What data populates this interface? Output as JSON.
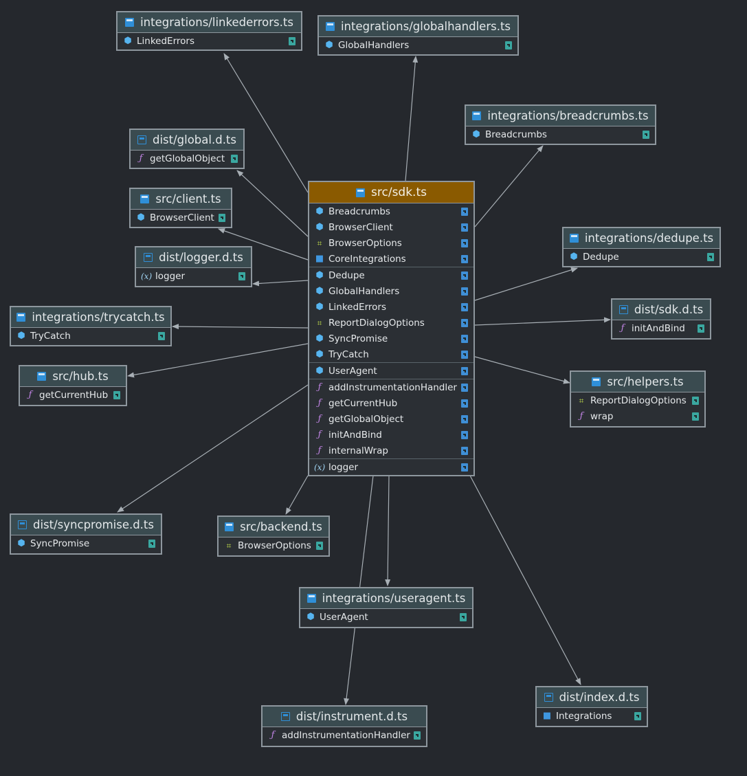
{
  "colors": {
    "background": "#25282d",
    "main_header": "#8a5a00",
    "node_header": "#3a4b50",
    "edge": "#a8afb5",
    "class_icon": "#56b4ef",
    "function_icon": "#c285e6",
    "interface_icon": "#b8d34a",
    "export_icon": "#3aa7a0"
  },
  "main": {
    "title": "src/sdk.ts",
    "items": [
      {
        "kind": "class",
        "icon": "class-icon",
        "label": "Breadcrumbs"
      },
      {
        "kind": "class",
        "icon": "class-icon",
        "label": "BrowserClient"
      },
      {
        "kind": "iface",
        "icon": "interface-icon",
        "label": "BrowserOptions"
      },
      {
        "kind": "mod",
        "icon": "module-file-icon",
        "label": "CoreIntegrations"
      },
      {
        "kind": "class",
        "icon": "class-icon",
        "label": "Dedupe"
      },
      {
        "kind": "class",
        "icon": "class-icon",
        "label": "GlobalHandlers"
      },
      {
        "kind": "class",
        "icon": "class-icon",
        "label": "LinkedErrors"
      },
      {
        "kind": "iface",
        "icon": "interface-icon",
        "label": "ReportDialogOptions"
      },
      {
        "kind": "class",
        "icon": "class-icon",
        "label": "SyncPromise"
      },
      {
        "kind": "class",
        "icon": "class-icon",
        "label": "TryCatch"
      },
      {
        "kind": "class",
        "icon": "class-icon",
        "label": "UserAgent"
      },
      {
        "kind": "fn",
        "icon": "function-icon",
        "label": "addInstrumentationHandler"
      },
      {
        "kind": "fn",
        "icon": "function-icon",
        "label": "getCurrentHub"
      },
      {
        "kind": "fn",
        "icon": "function-icon",
        "label": "getGlobalObject"
      },
      {
        "kind": "fn",
        "icon": "function-icon",
        "label": "initAndBind"
      },
      {
        "kind": "fn",
        "icon": "function-icon",
        "label": "internalWrap"
      },
      {
        "kind": "var",
        "icon": "variable-icon",
        "label": "logger"
      }
    ]
  },
  "nodes": [
    {
      "id": "linkederrors",
      "title": "integrations/linkederrors.ts",
      "dts": false,
      "items": [
        {
          "kind": "class",
          "label": "LinkedErrors"
        }
      ]
    },
    {
      "id": "globalhandlers",
      "title": "integrations/globalhandlers.ts",
      "dts": false,
      "items": [
        {
          "kind": "class",
          "label": "GlobalHandlers"
        }
      ]
    },
    {
      "id": "breadcrumbs",
      "title": "integrations/breadcrumbs.ts",
      "dts": false,
      "items": [
        {
          "kind": "class",
          "label": "Breadcrumbs"
        }
      ]
    },
    {
      "id": "global-dts",
      "title": "dist/global.d.ts",
      "dts": true,
      "items": [
        {
          "kind": "fn",
          "label": "getGlobalObject"
        }
      ]
    },
    {
      "id": "client",
      "title": "src/client.ts",
      "dts": false,
      "items": [
        {
          "kind": "class",
          "label": "BrowserClient"
        }
      ]
    },
    {
      "id": "logger-dts",
      "title": "dist/logger.d.ts",
      "dts": true,
      "items": [
        {
          "kind": "var",
          "label": "logger"
        }
      ]
    },
    {
      "id": "dedupe",
      "title": "integrations/dedupe.ts",
      "dts": false,
      "items": [
        {
          "kind": "class",
          "label": "Dedupe"
        }
      ]
    },
    {
      "id": "trycatch",
      "title": "integrations/trycatch.ts",
      "dts": false,
      "items": [
        {
          "kind": "class",
          "label": "TryCatch"
        }
      ]
    },
    {
      "id": "sdk-dts",
      "title": "dist/sdk.d.ts",
      "dts": true,
      "items": [
        {
          "kind": "fn",
          "label": "initAndBind"
        }
      ]
    },
    {
      "id": "hub",
      "title": "src/hub.ts",
      "dts": false,
      "items": [
        {
          "kind": "fn",
          "label": "getCurrentHub"
        }
      ]
    },
    {
      "id": "helpers",
      "title": "src/helpers.ts",
      "dts": false,
      "items": [
        {
          "kind": "iface",
          "label": "ReportDialogOptions"
        },
        {
          "kind": "fn",
          "label": "wrap"
        }
      ]
    },
    {
      "id": "syncpromise-dts",
      "title": "dist/syncpromise.d.ts",
      "dts": true,
      "items": [
        {
          "kind": "class",
          "label": "SyncPromise"
        }
      ]
    },
    {
      "id": "backend",
      "title": "src/backend.ts",
      "dts": false,
      "items": [
        {
          "kind": "iface",
          "label": "BrowserOptions"
        }
      ]
    },
    {
      "id": "useragent",
      "title": "integrations/useragent.ts",
      "dts": false,
      "items": [
        {
          "kind": "class",
          "label": "UserAgent"
        }
      ]
    },
    {
      "id": "index-dts",
      "title": "dist/index.d.ts",
      "dts": true,
      "items": [
        {
          "kind": "mod",
          "label": "Integrations"
        }
      ]
    },
    {
      "id": "instrument-dts",
      "title": "dist/instrument.d.ts",
      "dts": true,
      "items": [
        {
          "kind": "fn",
          "label": "addInstrumentationHandler"
        }
      ]
    }
  ]
}
